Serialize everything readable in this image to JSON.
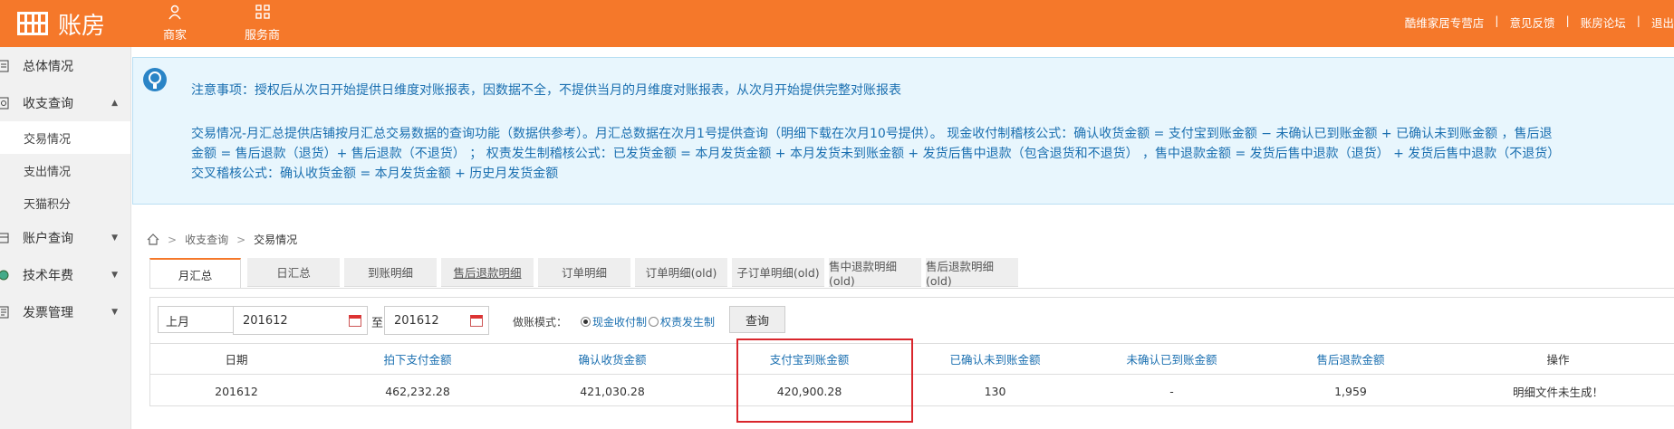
{
  "colors": {
    "brand": "#f5782a",
    "link": "#1a6fb0",
    "highlight": "#d9262c",
    "notice_bg": "#e8f6fd"
  },
  "header": {
    "logo_text": "账房",
    "nav": [
      {
        "label": "商家",
        "icon": "user-icon"
      },
      {
        "label": "服务商",
        "icon": "grid-icon"
      }
    ],
    "links": {
      "store": "酷维家居专营店",
      "sep": "|",
      "feedback": "意见反馈",
      "forum": "账房论坛",
      "logout": "退出"
    }
  },
  "sidebar": {
    "items": [
      {
        "label": "总体情况",
        "icon": "report-icon"
      },
      {
        "label": "收支查询",
        "icon": "search-doc-icon",
        "expanded": true
      },
      {
        "label": "账户查询",
        "icon": "account-icon"
      },
      {
        "label": "技术年费",
        "icon": "fee-icon"
      },
      {
        "label": "发票管理",
        "icon": "invoice-icon"
      }
    ],
    "subitems": [
      "交易情况",
      "支出情况",
      "天猫积分"
    ]
  },
  "notice": {
    "line1": "注意事项：授权后从次日开始提供日维度对账报表，因数据不全，不提供当月的月维度对账报表，从次月开始提供完整对账报表",
    "line2": "交易情况-月汇总提供店铺按月汇总交易数据的查询功能（数据供参考）。月汇总数据在次月1号提供查询（明细下载在次月10号提供）。 现金收付制稽核公式：确认收货金额 = 支付宝到账金额 − 未确认已到账金额 + 已确认未到账金额 ，售后退",
    "line3": "金额 = 售后退款（退货）+ 售后退款（不退货） ； 权责发生制稽核公式：已发货金额 = 本月发货金额 + 本月发货未到账金额 + 发货后售中退款（包含退货和不退货） ，售中退款金额 = 发货后售中退款（退货） + 发货后售中退款（不退货）",
    "line4": "交叉稽核公式：确认收货金额 = 本月发货金额 + 历史月发货金额"
  },
  "breadcrumb": {
    "level1": "收支查询",
    "level2": "交易情况",
    "sep": ">"
  },
  "tabs": [
    "月汇总",
    "日汇总",
    "到账明细",
    "售后退款明细",
    "订单明细",
    "订单明细(old)",
    "子订单明细(old)",
    "售中退款明细(old)",
    "售后退款明细(old)"
  ],
  "filter": {
    "period": "上月",
    "date_from": "201612",
    "to_label": "至",
    "date_to": "201612",
    "mode_label": "做账模式：",
    "mode_cash": "现金收付制",
    "mode_accrual": "权责发生制",
    "query_button": "查询"
  },
  "table": {
    "headers": [
      "日期",
      "拍下支付金额",
      "确认收货金额",
      "支付宝到账金额",
      "已确认未到账金额",
      "未确认已到账金额",
      "售后退款金额",
      "操作"
    ],
    "rows": [
      [
        "201612",
        "462,232.28",
        "421,030.28",
        "420,900.28",
        "130",
        "-",
        "1,959",
        "明细文件未生成！"
      ]
    ]
  }
}
